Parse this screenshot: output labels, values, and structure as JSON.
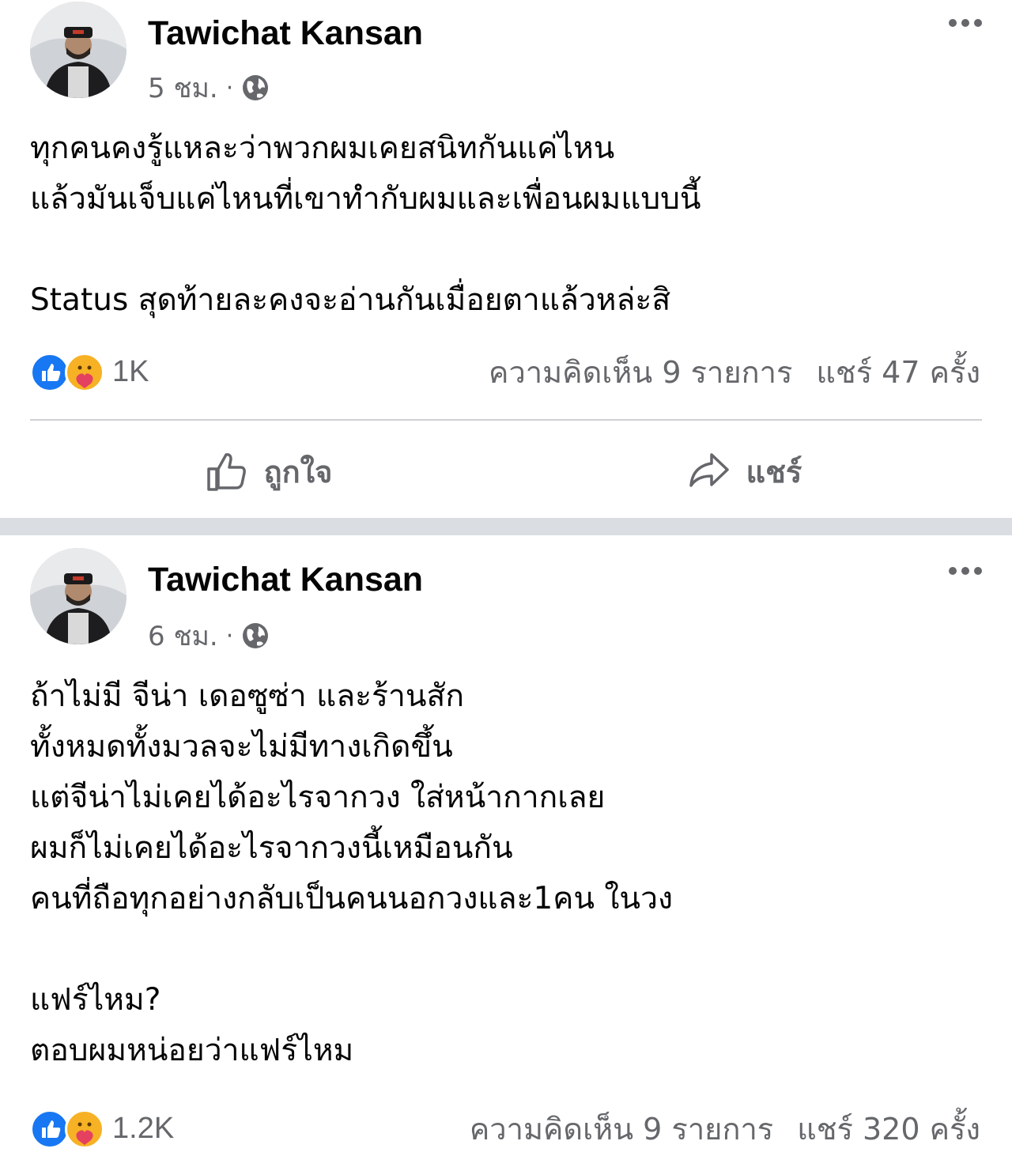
{
  "posts": [
    {
      "author": "Tawichat Kansan",
      "time": "5 ชม.",
      "separator": "·",
      "privacy_icon": "globe-icon",
      "lines": [
        "ทุกคนคงรู้แหละว่าพวกผมเคยสนิทกันแค่ไหน",
        "แล้วมันเจ็บแค่ไหนที่เขาทำกับผมและเพื่อนผมแบบนี้",
        "",
        "Status สุดท้ายละคงจะอ่านกันเมื่อยตาแล้วหล่ะสิ"
      ],
      "reaction_count": "1K",
      "comments": "ความคิดเห็น 9 รายการ",
      "shares": "แชร์ 47 ครั้ง",
      "like_label": "ถูกใจ",
      "share_label": "แชร์"
    },
    {
      "author": "Tawichat Kansan",
      "time": "6 ชม.",
      "separator": "·",
      "privacy_icon": "globe-icon",
      "lines": [
        "ถ้าไม่มี จีน่า เดอซูซ่า และร้านสัก",
        "ทั้งหมดทั้งมวลจะไม่มีทางเกิดขึ้น",
        "แต่จีน่าไม่เคยได้อะไรจากวง ใส่หน้ากากเลย",
        "ผมก็ไม่เคยได้อะไรจากวงนี้เหมือนกัน",
        "คนที่ถือทุกอย่างกลับเป็นคนนอกวงและ1คน ในวง",
        "",
        "แฟร์ไหม?",
        "ตอบผมหน่อยว่าแฟร์ไหม"
      ],
      "reaction_count": "1.2K",
      "comments": "ความคิดเห็น 9 รายการ",
      "shares": "แชร์ 320 ครั้ง"
    }
  ],
  "colors": {
    "like_blue": "#1877f2",
    "care_yellow": "#f7b125",
    "care_heart": "#e4405f",
    "meta_gray": "#65676b",
    "separator_gray": "#dadde1"
  }
}
